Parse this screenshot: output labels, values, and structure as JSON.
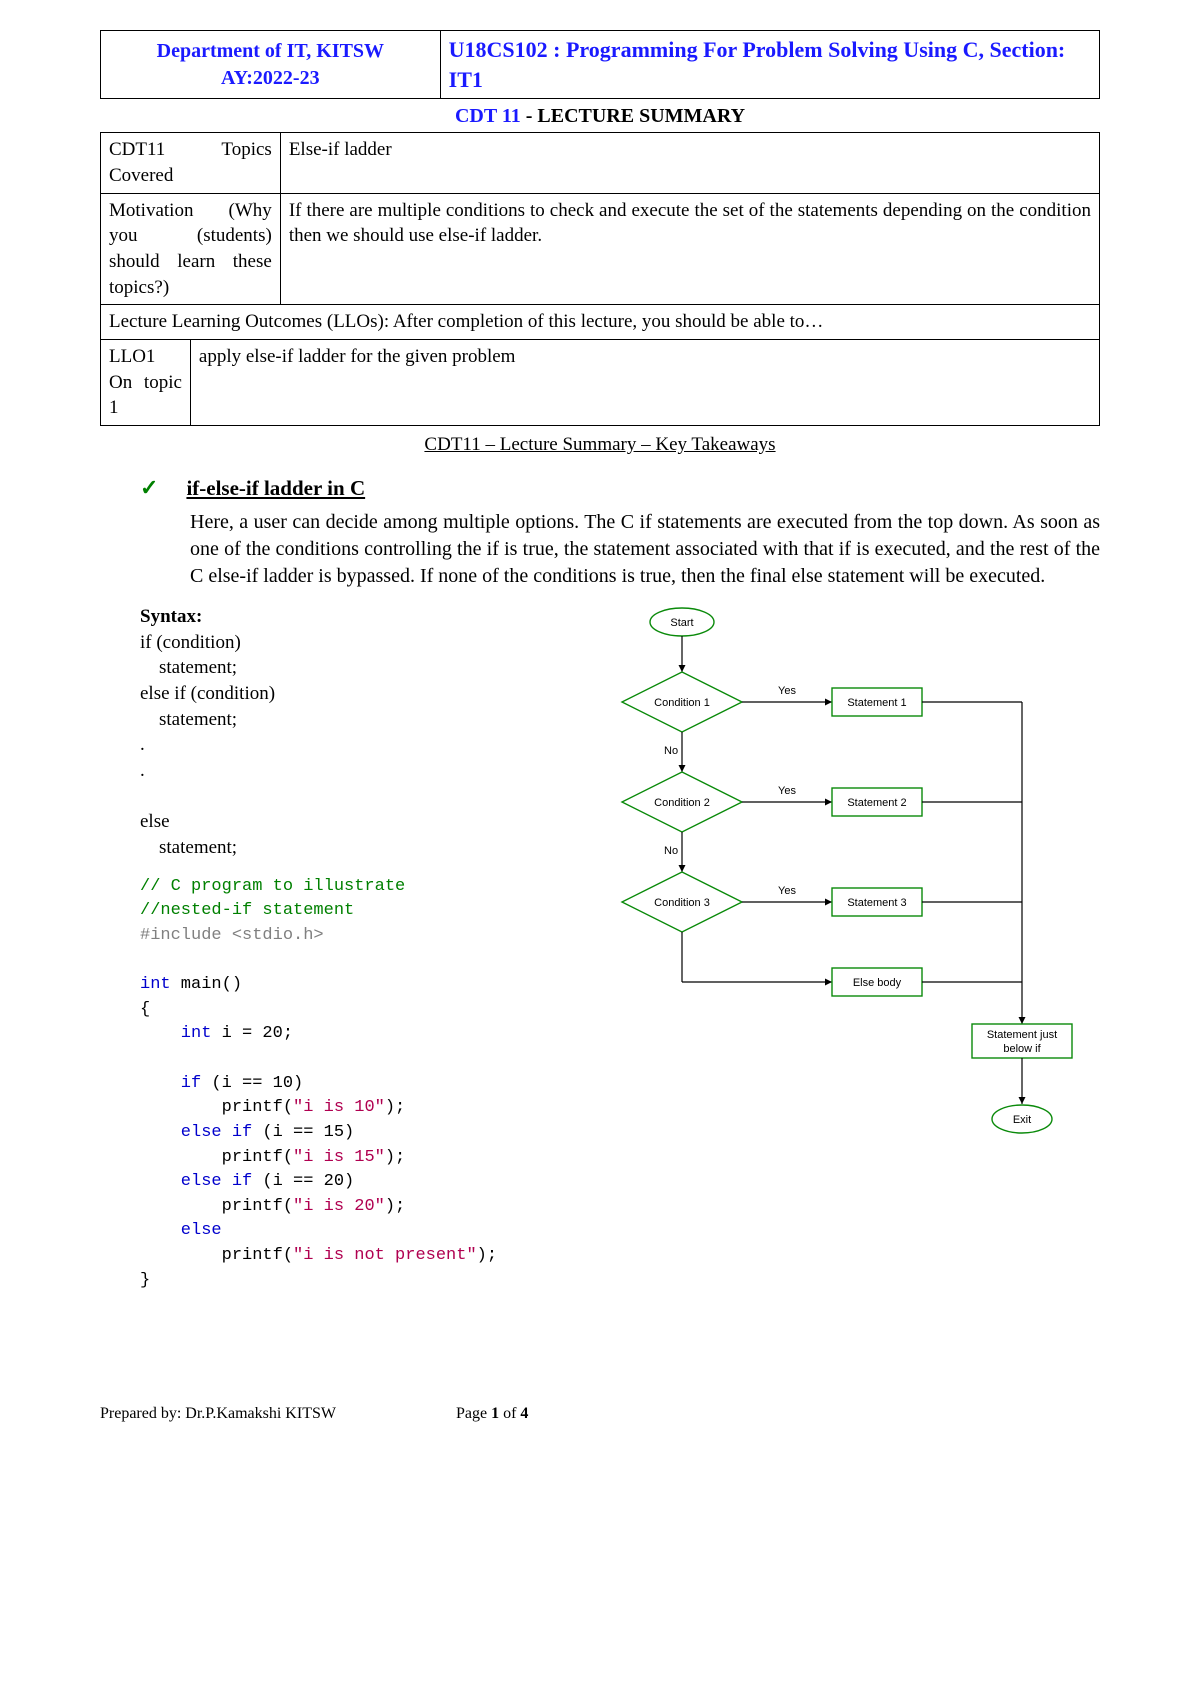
{
  "header": {
    "dept_line1": "Department of IT, KITSW",
    "dept_line2": "AY:2022-23",
    "course": "U18CS102 : Programming  For Problem Solving Using C, Section: IT1"
  },
  "lecture_title_blue": "CDT 11",
  "lecture_title_rest": " - LECTURE SUMMARY",
  "info": {
    "topics_label": "CDT11 Topics Covered",
    "topics_value": "Else-if ladder",
    "motivation_label": "Motivation (Why you (students) should learn these topics?)",
    "motivation_value": "If there are multiple conditions to check and execute the set of the statements depending on the condition then we should use else-if ladder.",
    "llo_intro": "Lecture Learning Outcomes (LLOs): After completion of this lecture, you should be able to…",
    "llo1_label": "LLO1 On topic 1",
    "llo1_value": "apply else-if ladder for the given problem"
  },
  "subheading": "CDT11 – Lecture Summary – Key Takeaways",
  "topic_title": "if-else-if ladder in C",
  "paragraph": "Here, a user can decide among multiple options. The C if statements are executed from the top down. As soon as one of the conditions controlling the if is true, the statement associated with that if is executed, and the rest of the C else-if ladder is bypassed. If none of the conditions is true, then the final else statement will be executed.",
  "syntax_label": "Syntax:",
  "syntax_lines": "if (condition)\n    statement;\nelse if (condition)\n    statement;\n.\n.\n\nelse\n    statement;",
  "code": {
    "cmt1": "// C program to illustrate",
    "cmt2": "//nested-if statement",
    "inc": "#include <stdio.h>",
    "kw_int": "int",
    "main": " main()",
    "lbrace": "{",
    "decl_kw": "    int",
    "decl_rest": " i = 20;",
    "if_kw": "    if",
    "if_cond": " (i == 10)",
    "p1a": "        printf(",
    "s1": "\"i is 10\"",
    "p_end": ");",
    "elif_kw": "    else if",
    "elif1_cond": " (i == 15)",
    "s2": "\"i is 15\"",
    "elif2_cond": " (i == 20)",
    "s3": "\"i is 20\"",
    "else_kw": "    else",
    "s4": "\"i is not present\"",
    "rbrace": "}"
  },
  "flowchart": {
    "start": "Start",
    "c1": "Condition 1",
    "c2": "Condition 2",
    "c3": "Condition 3",
    "st1": "Statement 1",
    "st2": "Statement 2",
    "st3": "Statement 3",
    "else_body": "Else body",
    "stmt_below": "Statement just\nbelow if",
    "yes": "Yes",
    "no": "No",
    "exit": "Exit"
  },
  "footer": {
    "prepared": "Prepared by: Dr.P.Kamakshi KITSW",
    "page_a": "Page ",
    "page_num": "1",
    "page_b": " of ",
    "page_total": "4"
  }
}
